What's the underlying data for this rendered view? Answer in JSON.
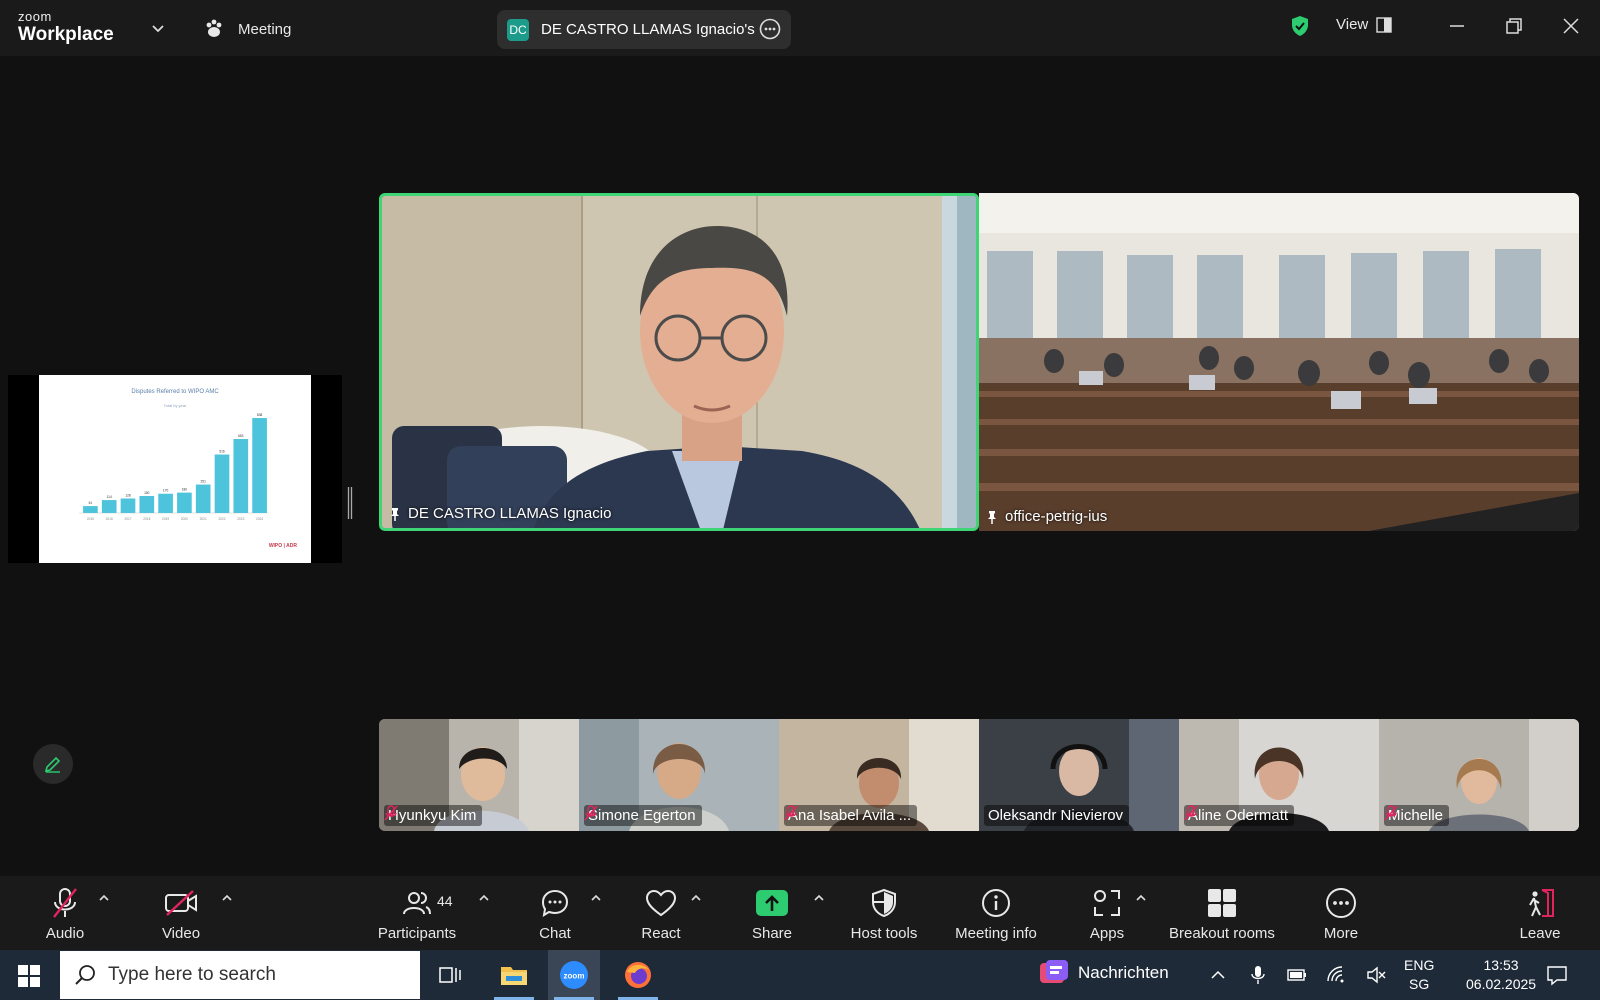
{
  "app": {
    "logo_line1": "zoom",
    "logo_line2": "Workplace",
    "meeting_label": "Meeting",
    "share_title": "DE CASTRO LLAMAS Ignacio's sc",
    "share_avatar": "DC",
    "view_label": "View"
  },
  "shared_slide": {
    "title": "Disputes Referred to WIPO AMC",
    "subtitle": "Total by year",
    "logo_text": "WIPO | ADR",
    "chart_data": {
      "type": "bar",
      "title": "Disputes Referred to WIPO AMC",
      "subtitle": "Total by year",
      "categories": [
        "2015",
        "2016",
        "2017",
        "2018",
        "2019",
        "2020",
        "2021",
        "2022",
        "2023",
        "2024"
      ],
      "values": [
        61,
        114,
        128,
        150,
        170,
        180,
        251,
        516,
        653,
        838
      ],
      "ylim": [
        0,
        900
      ],
      "color": "#4ec4dc"
    }
  },
  "tiles": {
    "main": {
      "name": "DE CASTRO LLAMAS Ignacio"
    },
    "room": {
      "name": "office-petrig-ius"
    }
  },
  "participants_strip": [
    {
      "name": "Hyunkyu Kim",
      "muted": true
    },
    {
      "name": "Simone Egerton",
      "muted": true
    },
    {
      "name": "Ana Isabel Avila ...",
      "muted": true
    },
    {
      "name": "Oleksandr Nievierov",
      "muted": false
    },
    {
      "name": "Aline Odermatt",
      "muted": true
    },
    {
      "name": "Michelle",
      "muted": true
    }
  ],
  "toolbar": {
    "audio": "Audio",
    "video": "Video",
    "participants": "Participants",
    "participants_count": "44",
    "chat": "Chat",
    "react": "React",
    "share": "Share",
    "host_tools": "Host tools",
    "meeting_info": "Meeting info",
    "apps": "Apps",
    "breakout_rooms": "Breakout rooms",
    "more": "More",
    "leave": "Leave"
  },
  "taskbar": {
    "search_placeholder": "Type here to search",
    "news_label": "Nachrichten",
    "lang1": "ENG",
    "lang2": "SG",
    "time": "13:53",
    "date": "06.02.2025"
  },
  "colors": {
    "active_speaker_border": "#3fd476",
    "share_button": "#2ecc71",
    "leave_icon": "#e0245e",
    "muted_mic": "#e0245e"
  }
}
